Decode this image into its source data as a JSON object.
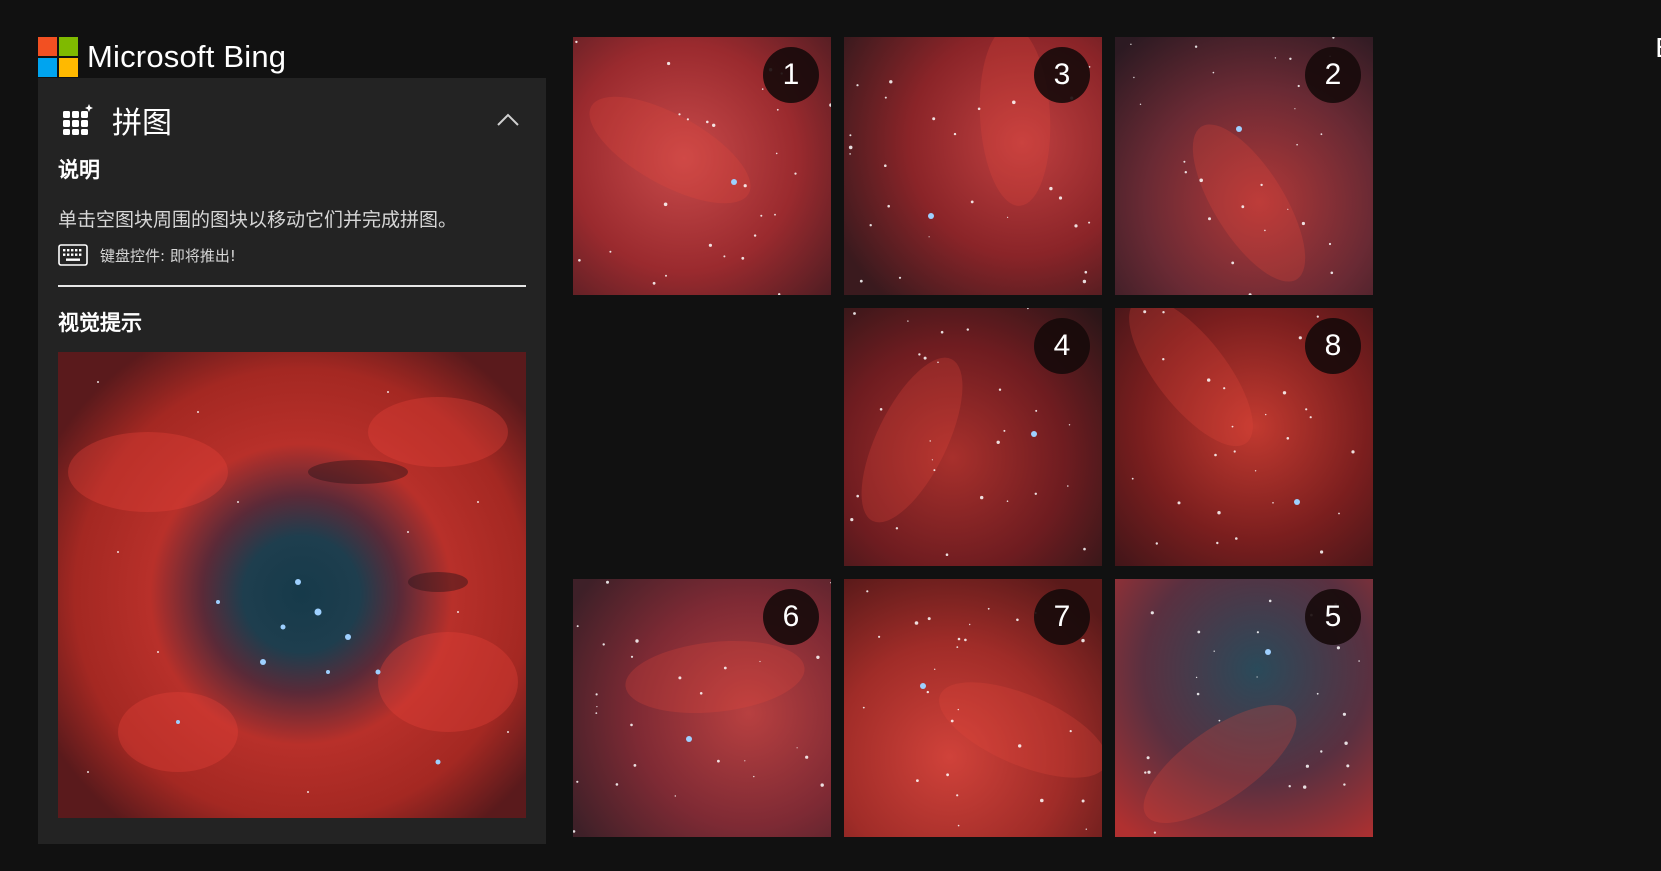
{
  "brand": {
    "name": "Microsoft Bing",
    "logo_colors": [
      "#f25022",
      "#7fba00",
      "#00a4ef",
      "#ffb900"
    ]
  },
  "panel": {
    "icon": "puzzle-grid-icon",
    "title": "拼图",
    "collapse_icon": "chevron-up-icon",
    "instructions_heading": "说明",
    "instructions_text": "单击空图块周围的图块以移动它们并完成拼图。",
    "keyboard_icon": "keyboard-icon",
    "keyboard_text": "键盘控件: 即将推出!",
    "visual_hint_heading": "视觉提示",
    "visual_hint_image": "rosette-nebula-reference"
  },
  "board": {
    "rows": 3,
    "cols": 3,
    "tiles": [
      {
        "label": "1",
        "empty": false
      },
      {
        "label": "3",
        "empty": false
      },
      {
        "label": "2",
        "empty": false
      },
      {
        "label": "",
        "empty": true
      },
      {
        "label": "4",
        "empty": false
      },
      {
        "label": "8",
        "empty": false
      },
      {
        "label": "6",
        "empty": false
      },
      {
        "label": "7",
        "empty": false
      },
      {
        "label": "5",
        "empty": false
      }
    ]
  },
  "colors": {
    "background": "#111111",
    "panel": "#232323",
    "nebula_red": "#b8302a",
    "nebula_core": "#1e3e4e"
  }
}
